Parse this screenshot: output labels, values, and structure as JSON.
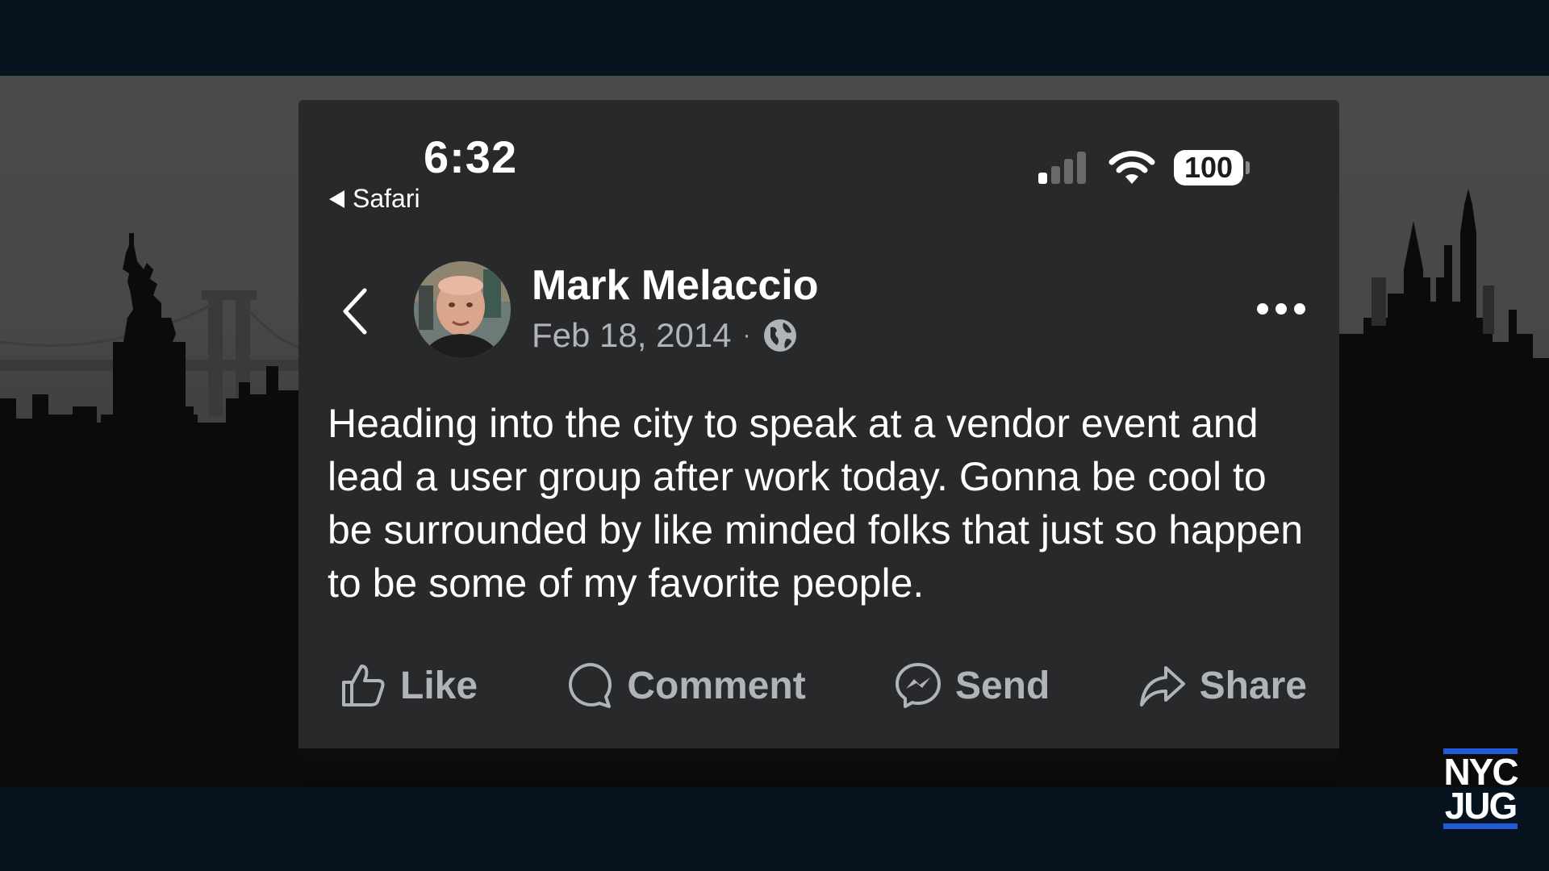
{
  "status_bar": {
    "time": "6:32",
    "back_app": "Safari",
    "battery": "100"
  },
  "post": {
    "author": "Mark Melaccio",
    "date": "Feb 18, 2014",
    "separator": "·",
    "text": "Heading into the city to speak at a vendor event and lead a user group after work today. Gonna be cool to be surrounded by like minded folks that just so happen to be some of my favorite people."
  },
  "actions": {
    "like": "Like",
    "comment": "Comment",
    "send": "Send",
    "share": "Share"
  },
  "logo": {
    "line1": "NYC",
    "line2": "JUG"
  },
  "icons": [
    "back-triangle-icon",
    "cellular-signal-icon",
    "wifi-icon",
    "battery-icon",
    "back-chevron-icon",
    "globe-icon",
    "more-icon",
    "like-icon",
    "comment-icon",
    "messenger-icon",
    "share-icon"
  ],
  "colors": {
    "card_background": "#27292b",
    "secondary_text": "#b0b3b8",
    "logo_accent": "#1f5bd6"
  }
}
